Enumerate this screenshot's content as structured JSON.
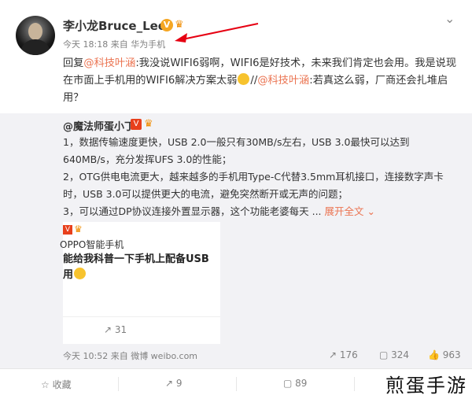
{
  "header": {
    "username": "李小龙Bruce_Lee",
    "verified_badge": "V",
    "time": "今天 18:18",
    "source_prefix": "来自",
    "source": "华为手机"
  },
  "reply": {
    "prefix": "回复",
    "mention1": "@科技叶涵",
    "text1": ":我没说WIFI6弱啊，WIFI6是好技术，未来我们肯定也会用。我是说现在市面上手机用的WIFI6解决方案太弱",
    "separator": "//",
    "mention2": "@科技叶涵",
    "text2": ":若真这么弱，厂商还会扎堆启用？"
  },
  "quote": {
    "username": "@魔法师蛋小丁",
    "badge": "V",
    "line1": "1，数据传输速度更快，USB 2.0一般只有30MB/s左右，USB 3.0最快可以达到640MB/s，充分发挥UFS 3.0的性能；",
    "line2": "2，OTG供电电流更大，越来越多的手机用Type-C代替3.5mm耳机接口，连接数字声卡时，USB 3.0可以提供更大的电流，避免突然断开或无声的问题；",
    "line3": "3，可以通过DP协议连接外置显示器，这个功能老婆每天 ...",
    "expand": "展开全文",
    "card": {
      "badge": "V",
      "user": "OPPO智能手机",
      "line1": "能给我科普一下手机上配备USB",
      "line2": "用",
      "share_count": "31"
    },
    "meta": "今天 10:52 来自 微博 weibo.com",
    "share": "176",
    "comments": "324",
    "likes": "963"
  },
  "bottom": {
    "favorite": "收藏",
    "share": "9",
    "comment": "89"
  },
  "watermark": "煎蛋手游"
}
